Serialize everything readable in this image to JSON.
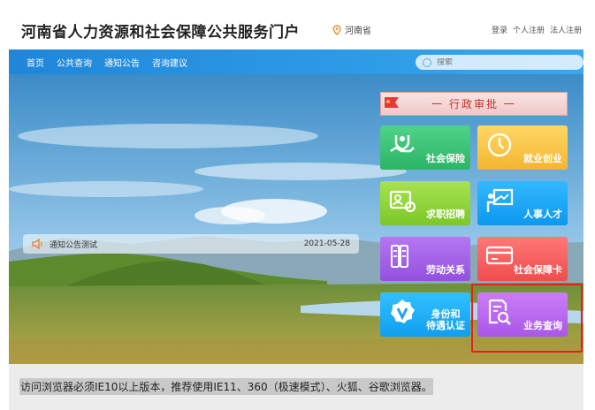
{
  "header": {
    "site_title": "河南省人力资源和社会保障公共服务门户",
    "location": "河南省",
    "links": [
      "登录",
      "个人注册",
      "法人注册"
    ]
  },
  "nav": {
    "items": [
      "首页",
      "公共查询",
      "通知公告",
      "咨询建议"
    ],
    "search_placeholder": "搜索"
  },
  "notice": {
    "text": "通知公告测试",
    "date": "2021-05-28"
  },
  "approval": {
    "label": "一 行政审批 一"
  },
  "tiles": {
    "social_insurance": "社会保险",
    "employment": "就业创业",
    "job_seeking": "求职招聘",
    "human_resources": "人事人才",
    "labor_relations": "劳动关系",
    "social_security_card": "社会保障卡",
    "identity_line1": "身份和",
    "identity_line2": "待遇认证",
    "business_query": "业务查询"
  },
  "caption": "访问浏览器必须IE10以上版本，推荐使用IE11、360（极速模式）、火狐、谷歌浏览器。",
  "colors": {
    "nav_blue": "#1f86d9",
    "highlight_red": "#e62020",
    "social_green": "#2cb565",
    "employment_yellow": "#f4b530",
    "job_green": "#7cc72a",
    "hr_blue": "#0d98ee",
    "labor_purple": "#9450de",
    "card_red": "#ef4d4d",
    "business_purple": "#a957e8"
  }
}
